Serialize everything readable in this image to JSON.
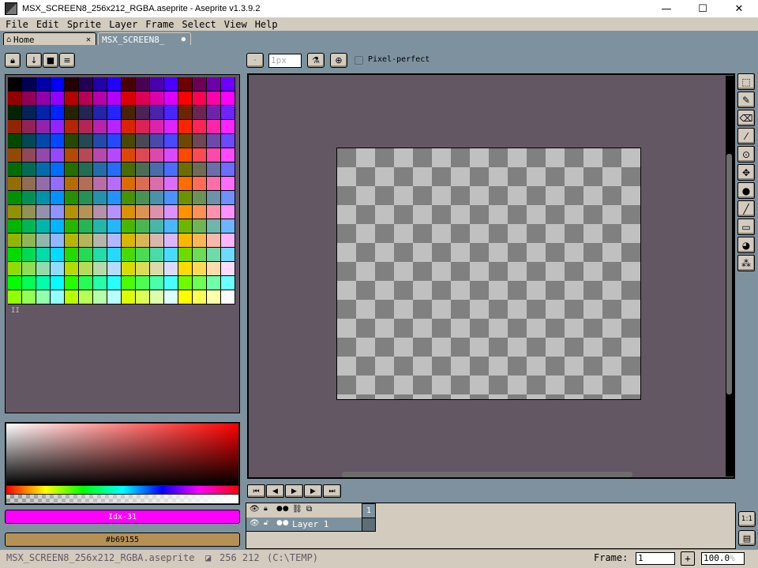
{
  "window": {
    "title": "MSX_SCREEN8_256x212_RGBA.aseprite - Aseprite v1.3.9.2",
    "minimize": "—",
    "maximize": "☐",
    "close": "✕"
  },
  "menu": {
    "items": [
      {
        "label": "File"
      },
      {
        "label": "Edit"
      },
      {
        "label": "Sprite"
      },
      {
        "label": "Layer"
      },
      {
        "label": "Frame"
      },
      {
        "label": "Select"
      },
      {
        "label": "View"
      },
      {
        "label": "Help"
      }
    ]
  },
  "tabs": {
    "home_label": "Home",
    "home_close": "✕",
    "active_label": "MSX_SCREEN8_",
    "active_dot": "●"
  },
  "toolbar": {
    "brush_size": "1px",
    "pixel_perfect_label": "Pixel-perfect"
  },
  "palette": {
    "indicator": "II",
    "index_label": "Idx-31",
    "index_color": "#ff00ff",
    "hex_label": "#b69155",
    "hex_color": "#b69155"
  },
  "timeline": {
    "frame_number": "1",
    "layer_name": "Layer 1"
  },
  "status": {
    "filename": "MSX_SCREEN8_256x212_RGBA.aseprite",
    "dimensions": "256 212",
    "path": "(C:\\TEMP)",
    "frame_label": "Frame:",
    "frame_value": "1",
    "add_frame": "+",
    "zoom": "100.0",
    "zoom_unit": "%"
  },
  "colors": {
    "ui_bg": "#7d929e",
    "panel": "#d3cbbe",
    "canvas_bg": "#645764",
    "index_fill": "#ff00ff",
    "hex_fill": "#b69155"
  }
}
